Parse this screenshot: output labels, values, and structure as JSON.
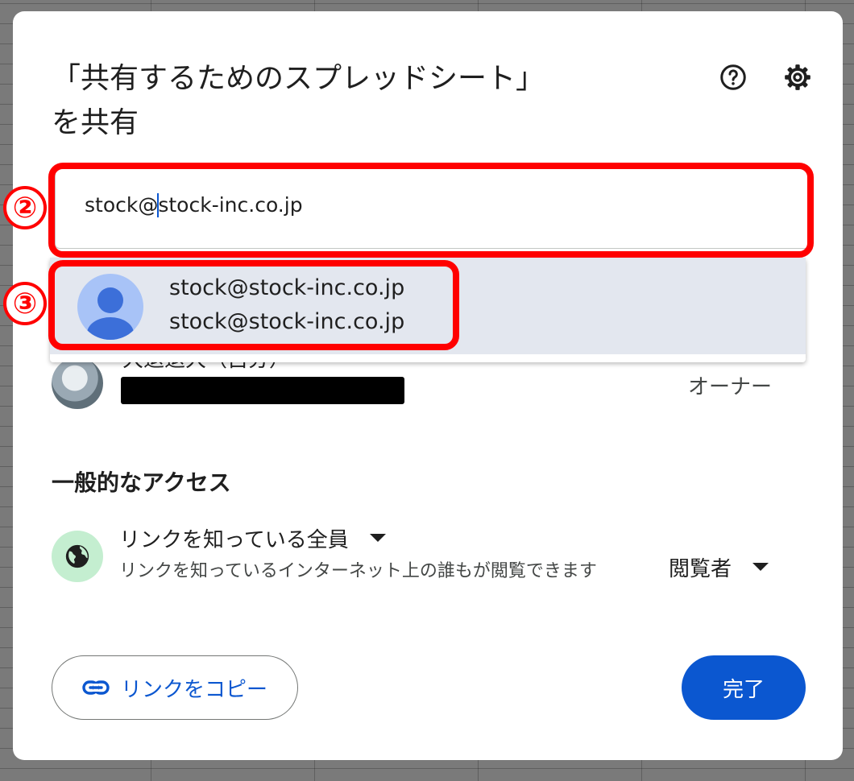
{
  "dialog": {
    "title_line1": "「共有するためのスプレッドシート」",
    "title_line2": "を共有",
    "help_icon": "help-circle-icon",
    "settings_icon": "gear-icon"
  },
  "input": {
    "value_before_caret": "stock@",
    "value_after_caret": "stock-inc.co.jp"
  },
  "suggestion": {
    "name": "stock@stock-inc.co.jp",
    "email": "stock@stock-inc.co.jp",
    "avatar_icon": "person-icon"
  },
  "owner": {
    "name": "大退退大（自分）",
    "role": "オーナー"
  },
  "general_access": {
    "heading": "一般的なアクセス",
    "scope_label": "リンクを知っている全員",
    "description": "リンクを知っているインターネット上の誰もが閲覧できます",
    "role_label": "閲覧者",
    "globe_icon": "globe-icon"
  },
  "buttons": {
    "copy_link": "リンクをコピー",
    "done": "完了",
    "link_icon": "link-icon"
  },
  "annotations": {
    "step2": "②",
    "step3": "③",
    "color": "#ff0000"
  },
  "colors": {
    "primary": "#0b57d0",
    "suggest_bg": "#e3e7ef",
    "globe_bg": "#c4eed0"
  }
}
